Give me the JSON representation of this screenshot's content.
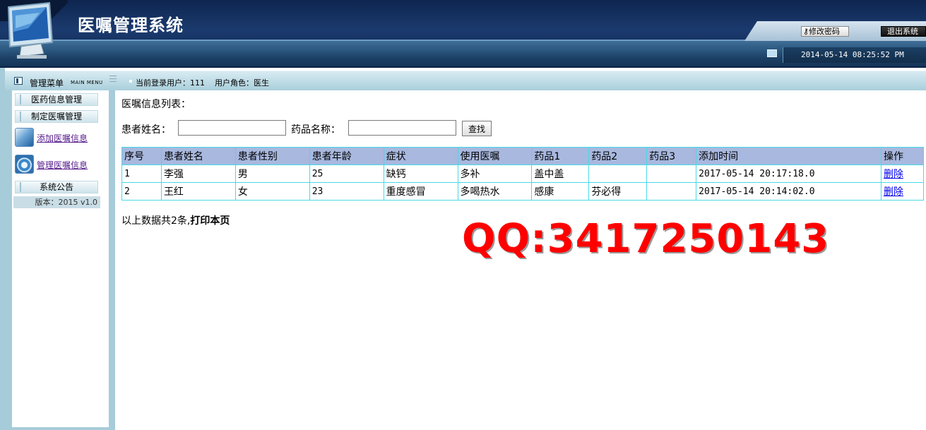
{
  "header": {
    "title": "医嘱管理系统",
    "change_password": "修改密码",
    "logout": "退出系统",
    "datetime": "2014-05-14 08:25:52 PM"
  },
  "menubar": {
    "title": "管理菜单",
    "subtitle": "MAIN MENU",
    "current_user": "当前登录用户：111",
    "user_role": "用户角色：医生"
  },
  "sidebar": {
    "group1": "医药信息管理",
    "group2": "制定医嘱管理",
    "items": [
      {
        "label": "添加医嘱信息",
        "icon": "add-document-icon"
      },
      {
        "label": "管理医嘱信息",
        "icon": "gear-icon"
      }
    ],
    "group3": "系统公告",
    "version": "版本：2015 v1.0"
  },
  "main": {
    "list_title": "医嘱信息列表：",
    "search": {
      "patient_label": "患者姓名：",
      "patient_value": "",
      "drug_label": "药品名称：",
      "drug_value": "",
      "button": "查找"
    },
    "table": {
      "headers": [
        "序号",
        "患者姓名",
        "患者性别",
        "患者年龄",
        "症状",
        "使用医嘱",
        "药品1",
        "药品2",
        "药品3",
        "添加时间",
        "操作"
      ],
      "rows": [
        [
          "1",
          "李强",
          "男",
          "25",
          "缺钙",
          "多补",
          "盖中盖",
          "",
          "",
          "2017-05-14 20:17:18.0",
          "删除"
        ],
        [
          "2",
          "王红",
          "女",
          "23",
          "重度感冒",
          "多喝热水",
          "感康",
          "芬必得",
          "",
          "2017-05-14 20:14:02.0",
          "删除"
        ]
      ]
    },
    "total_text": "以上数据共2条,",
    "print_link": "打印本页",
    "watermark": "QQ:3417250143"
  }
}
